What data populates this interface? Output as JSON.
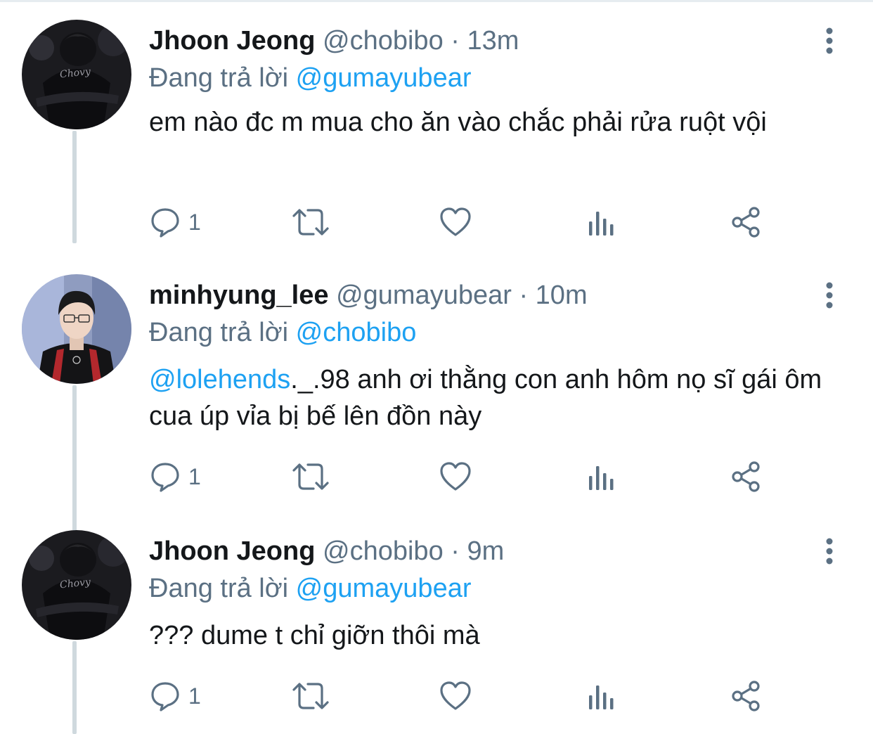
{
  "thread": [
    {
      "avatar": "player-jacket-photo",
      "name": "Jhoon Jeong",
      "handle": "@chobibo",
      "separator": "·",
      "time": "13m",
      "replying_prefix": "Đang trả lời ",
      "replying_to": "@gumayubear",
      "body": [
        {
          "text": "em nào đc m mua cho ăn vào chắc phải rửa ruột vội"
        }
      ],
      "reply_count": "1"
    },
    {
      "avatar": "player-portrait-photo",
      "name": "minhyung_lee",
      "handle": "@gumayubear",
      "separator": "·",
      "time": "10m",
      "replying_prefix": "Đang trả lời ",
      "replying_to": "@chobibo",
      "body": [
        {
          "text": "@lolehends",
          "mention": true
        },
        {
          "text": "._.98 anh ơi thằng con anh hôm nọ sĩ gái ôm cua úp vỉa bị bế lên đồn này"
        }
      ],
      "reply_count": "1"
    },
    {
      "avatar": "player-jacket-photo",
      "name": "Jhoon Jeong",
      "handle": "@chobibo",
      "separator": "·",
      "time": "9m",
      "replying_prefix": "Đang trả lời ",
      "replying_to": "@gumayubear",
      "body": [
        {
          "text": "??? dume t chỉ giỡn thôi mà"
        }
      ],
      "reply_count": "1"
    }
  ],
  "icons": {
    "reply": "reply-icon",
    "retweet": "retweet-icon",
    "like": "heart-icon",
    "analytics": "analytics-icon",
    "share": "share-icon",
    "more": "more-vertical-icon"
  },
  "colors": {
    "text": "#14171a",
    "secondary": "#5b7083",
    "link": "#1da1f2",
    "thread_line": "#cfd9de"
  }
}
